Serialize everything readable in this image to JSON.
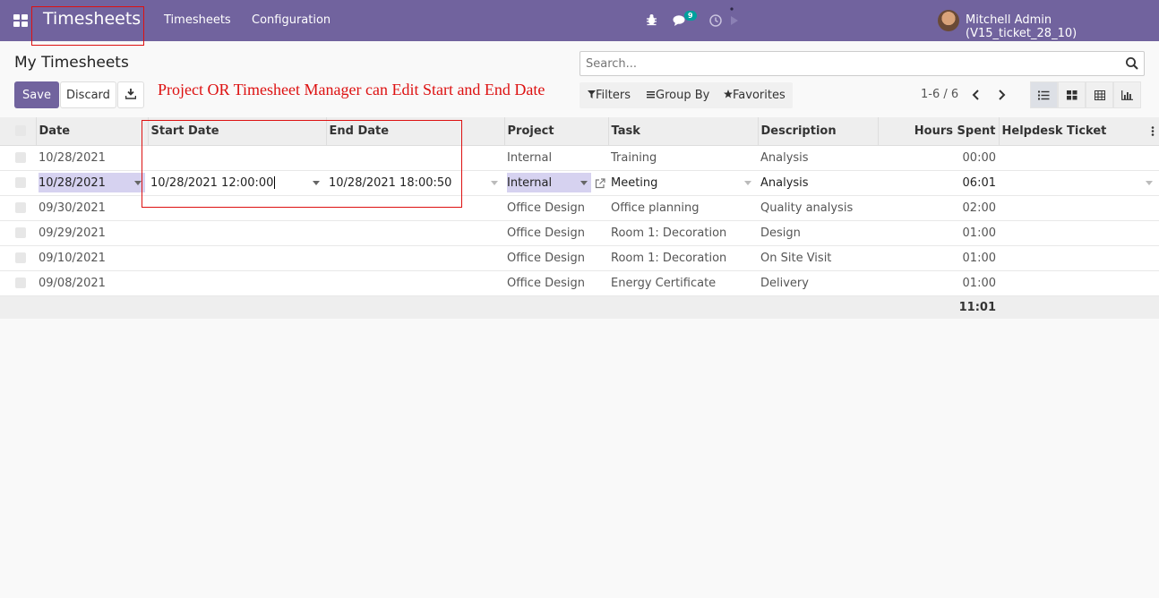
{
  "navbar": {
    "app_name": "Timesheets",
    "menu": [
      "Timesheets",
      "Configuration"
    ],
    "chat_badge": "9",
    "user": "Mitchell Admin (V15_ticket_28_10)"
  },
  "control_panel": {
    "title": "My Timesheets",
    "save_label": "Save",
    "discard_label": "Discard",
    "annotation": "Project OR Timesheet Manager can Edit Start and End Date",
    "search_placeholder": "Search...",
    "filters_label": "Filters",
    "group_by_label": "Group By",
    "favorites_label": "Favorites",
    "pager": "1-6 / 6"
  },
  "table": {
    "columns": [
      "Date",
      "Start Date",
      "End Date",
      "Project",
      "Task",
      "Description",
      "Hours Spent",
      "Helpdesk Ticket"
    ],
    "rows": [
      {
        "date": "10/28/2021",
        "start": "",
        "end": "",
        "project": "Internal",
        "task": "Training",
        "description": "Analysis",
        "hours": "00:00"
      },
      {
        "date": "10/28/2021",
        "start": "10/28/2021 12:00:00",
        "end": "10/28/2021 18:00:50",
        "project": "Internal",
        "task": "Meeting",
        "description": "Analysis",
        "hours": "06:01"
      },
      {
        "date": "09/30/2021",
        "start": "",
        "end": "",
        "project": "Office Design",
        "task": "Office planning",
        "description": "Quality analysis",
        "hours": "02:00"
      },
      {
        "date": "09/29/2021",
        "start": "",
        "end": "",
        "project": "Office Design",
        "task": "Room 1: Decoration",
        "description": "Design",
        "hours": "01:00"
      },
      {
        "date": "09/10/2021",
        "start": "",
        "end": "",
        "project": "Office Design",
        "task": "Room 1: Decoration",
        "description": "On Site Visit",
        "hours": "01:00"
      },
      {
        "date": "09/08/2021",
        "start": "",
        "end": "",
        "project": "Office Design",
        "task": "Energy Certificate",
        "description": "Delivery",
        "hours": "01:00"
      }
    ],
    "total_hours": "11:01"
  },
  "colors": {
    "brand": "#71639e",
    "annotation": "#dd1111",
    "highlight": "#d6d2f0"
  }
}
